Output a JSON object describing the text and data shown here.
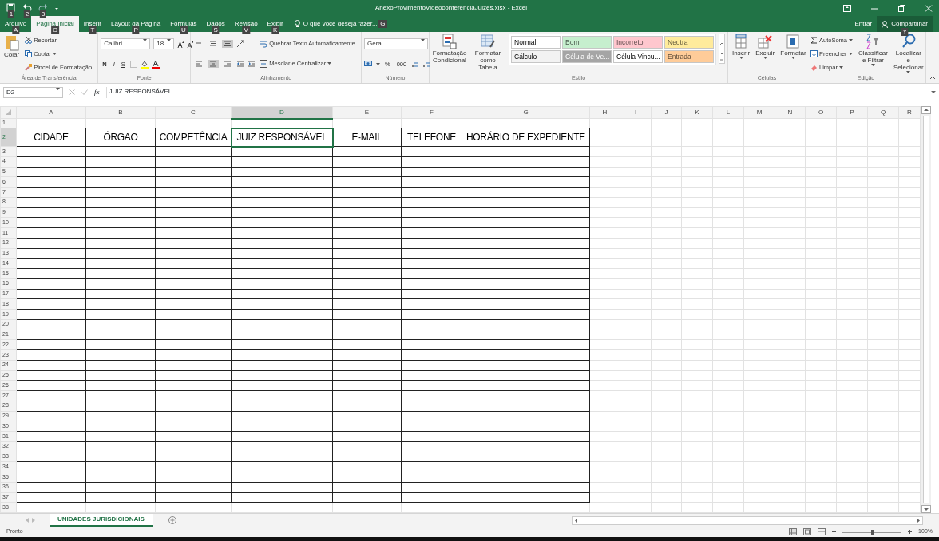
{
  "window": {
    "title": "AnexoProvimentoVideoconferênciaJuizes.xlsx - Excel"
  },
  "quick_access": [
    {
      "kind": "save",
      "keytip": "1"
    },
    {
      "kind": "undo",
      "keytip": "2"
    },
    {
      "kind": "redo",
      "keytip": "3"
    }
  ],
  "account": {
    "sign_in": "Entrar",
    "share": "Compartilhar",
    "share_keytip": "Y"
  },
  "tabs": [
    {
      "label": "Arquivo",
      "keytip": "A",
      "selected": false
    },
    {
      "label": "Página Inicial",
      "keytip": "C",
      "selected": true
    },
    {
      "label": "Inserir",
      "keytip": "T",
      "selected": false
    },
    {
      "label": "Layout da Página",
      "keytip": "P",
      "selected": false
    },
    {
      "label": "Fórmulas",
      "keytip": "U",
      "selected": false
    },
    {
      "label": "Dados",
      "keytip": "S",
      "selected": false
    },
    {
      "label": "Revisão",
      "keytip": "V",
      "selected": false
    },
    {
      "label": "Exibir",
      "keytip": "K",
      "selected": false
    }
  ],
  "tell_me": {
    "label": "O que você deseja fazer...",
    "keytip": "G"
  },
  "ribbon": [
    {
      "kind": "clipboard",
      "title": "Área de Transferência",
      "paste": "Colar",
      "cut": "Recortar",
      "copy": "Copiar",
      "format_painter": "Pincel de Formatação"
    },
    {
      "kind": "font",
      "title": "Fonte",
      "font_name": "Calibri",
      "font_size": "18",
      "bold": "N",
      "italic": "I",
      "underline": "S"
    },
    {
      "kind": "alignment",
      "title": "Alinhamento",
      "wrap_text": "Quebrar Texto Automaticamente",
      "merge": "Mesclar e Centralizar",
      "vertical": [
        {
          "selected": false
        },
        {
          "selected": false
        },
        {
          "selected": true
        }
      ],
      "horizontal": [
        {
          "selected": false
        },
        {
          "selected": true
        },
        {
          "selected": false
        }
      ]
    },
    {
      "kind": "number",
      "title": "Número",
      "format": "Geral",
      "percent": "%",
      "thousands": "000"
    },
    {
      "kind": "styles",
      "title": "Estilo",
      "conditional": "Formatação Condicional",
      "as_table": "Formatar como Tabela",
      "styles": [
        {
          "name": "Normal",
          "color": "#ffffff"
        },
        {
          "name": "Bom",
          "color": "#c6efce"
        },
        {
          "name": "Incorreto",
          "color": "#ffc7ce"
        },
        {
          "name": "Neutra",
          "color": "#ffeb9c"
        },
        {
          "name": "Cálculo",
          "color": "#f2f2f2"
        },
        {
          "name": "Célula de Ve...",
          "color": "#a5a5a5"
        },
        {
          "name": "Célula Vincu...",
          "color": "#ffffff"
        },
        {
          "name": "Entrada",
          "color": "#ffcc99"
        }
      ]
    },
    {
      "kind": "cells",
      "title": "Células",
      "insert": "Inserir",
      "delete": "Excluir",
      "format": "Formatar"
    },
    {
      "kind": "editing",
      "title": "Edição",
      "autosum": "AutoSoma",
      "fill": "Preencher",
      "clear": "Limpar",
      "sort": "Classificar e Filtrar",
      "find": "Localizar e Selecionar"
    }
  ],
  "formula_bar": {
    "name_box": "D2",
    "function_label": "fx",
    "formula": "JUIZ RESPONSÁVEL"
  },
  "sheet": {
    "columns": [
      {
        "label": "A",
        "selected": false
      },
      {
        "label": "B",
        "selected": false
      },
      {
        "label": "C",
        "selected": false
      },
      {
        "label": "D",
        "selected": true
      },
      {
        "label": "E",
        "selected": false
      },
      {
        "label": "F",
        "selected": false
      },
      {
        "label": "G",
        "selected": false
      },
      {
        "label": "H",
        "selected": false
      },
      {
        "label": "I",
        "selected": false
      },
      {
        "label": "J",
        "selected": false
      },
      {
        "label": "K",
        "selected": false
      },
      {
        "label": "L",
        "selected": false
      },
      {
        "label": "M",
        "selected": false
      },
      {
        "label": "N",
        "selected": false
      },
      {
        "label": "O",
        "selected": false
      },
      {
        "label": "P",
        "selected": false
      },
      {
        "label": "Q",
        "selected": false
      },
      {
        "label": "R",
        "selected": false
      }
    ],
    "rows": [
      {
        "label": "1",
        "selected": false
      },
      {
        "label": "2",
        "selected": true
      },
      {
        "label": "3",
        "selected": false
      },
      {
        "label": "4",
        "selected": false
      },
      {
        "label": "5",
        "selected": false
      },
      {
        "label": "6",
        "selected": false
      },
      {
        "label": "7",
        "selected": false
      },
      {
        "label": "8",
        "selected": false
      },
      {
        "label": "9",
        "selected": false
      },
      {
        "label": "10",
        "selected": false
      },
      {
        "label": "11",
        "selected": false
      },
      {
        "label": "12",
        "selected": false
      },
      {
        "label": "13",
        "selected": false
      },
      {
        "label": "14",
        "selected": false
      },
      {
        "label": "15",
        "selected": false
      },
      {
        "label": "16",
        "selected": false
      },
      {
        "label": "17",
        "selected": false
      },
      {
        "label": "18",
        "selected": false
      },
      {
        "label": "19",
        "selected": false
      },
      {
        "label": "20",
        "selected": false
      },
      {
        "label": "21",
        "selected": false
      },
      {
        "label": "22",
        "selected": false
      },
      {
        "label": "23",
        "selected": false
      },
      {
        "label": "24",
        "selected": false
      },
      {
        "label": "25",
        "selected": false
      },
      {
        "label": "26",
        "selected": false
      },
      {
        "label": "27",
        "selected": false
      },
      {
        "label": "28",
        "selected": false
      },
      {
        "label": "29",
        "selected": false
      },
      {
        "label": "30",
        "selected": false
      },
      {
        "label": "31",
        "selected": false
      },
      {
        "label": "32",
        "selected": false
      },
      {
        "label": "33",
        "selected": false
      },
      {
        "label": "34",
        "selected": false
      },
      {
        "label": "35",
        "selected": false
      },
      {
        "label": "36",
        "selected": false
      },
      {
        "label": "37",
        "selected": false
      },
      {
        "label": "38",
        "selected": false
      }
    ],
    "header_row": [
      "CIDADE",
      "ÓRGÃO",
      "COMPETÊNCIA",
      "JUIZ RESPONSÁVEL",
      "E-MAIL",
      "TELEFONE",
      "HORÁRIO DE EXPEDIENTE"
    ]
  },
  "sheet_tabs": [
    {
      "label": "UNIDADES JURISDICIONAIS",
      "selected": true
    }
  ],
  "status_bar": {
    "status": "Pronto",
    "zoom": "100%",
    "zoom_slider": {
      "level": 0.5
    }
  }
}
